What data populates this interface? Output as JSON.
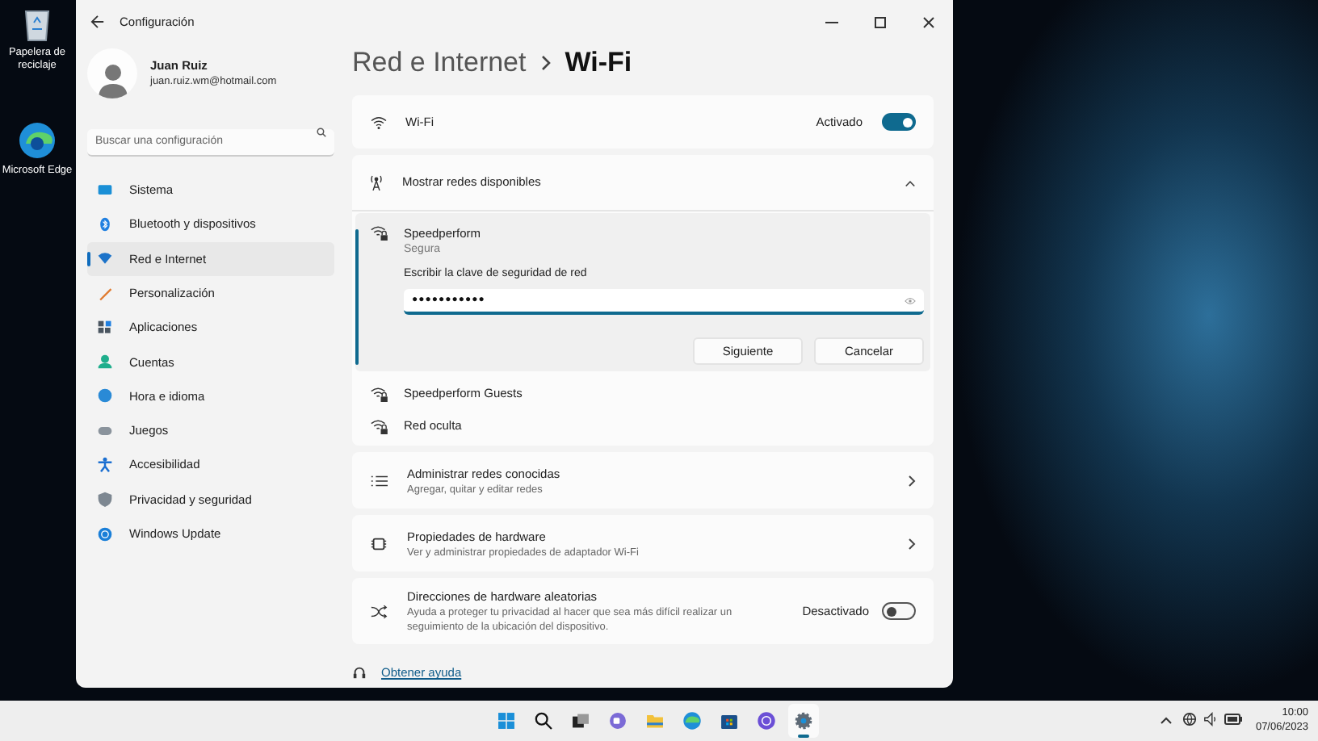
{
  "desktop_icons": [
    {
      "label": "Papelera de reciclaje",
      "kind": "recycle"
    },
    {
      "label": "Microsoft Edge",
      "kind": "edge"
    }
  ],
  "window": {
    "title": "Configuración"
  },
  "user": {
    "name": "Juan Ruiz",
    "email": "juan.ruiz.wm@hotmail.com"
  },
  "search": {
    "placeholder": "Buscar una configuración"
  },
  "sidebar": {
    "items": [
      {
        "label": "Sistema",
        "selected": false,
        "color": "#1a8fd6"
      },
      {
        "label": "Bluetooth y dispositivos",
        "selected": false,
        "color": "#1f7fe0"
      },
      {
        "label": "Red e Internet",
        "selected": true,
        "color": "#1c73c9"
      },
      {
        "label": "Personalización",
        "selected": false,
        "color": "#e07a2f"
      },
      {
        "label": "Aplicaciones",
        "selected": false,
        "color": "#4a5560"
      },
      {
        "label": "Cuentas",
        "selected": false,
        "color": "#1fae8c"
      },
      {
        "label": "Hora e idioma",
        "selected": false,
        "color": "#2a8ad6"
      },
      {
        "label": "Juegos",
        "selected": false,
        "color": "#8a939c"
      },
      {
        "label": "Accesibilidad",
        "selected": false,
        "color": "#1b6fd1"
      },
      {
        "label": "Privacidad y seguridad",
        "selected": false,
        "color": "#7d8791"
      },
      {
        "label": "Windows Update",
        "selected": false,
        "color": "#1a7fd8"
      }
    ]
  },
  "breadcrumb": [
    "Red e Internet",
    "Wi-Fi"
  ],
  "wifi": {
    "label": "Wi-Fi",
    "state": "Activado",
    "on": true
  },
  "networks": {
    "title": "Mostrar redes disponibles",
    "expanded": true,
    "items": [
      {
        "name": "Speedperform",
        "status": "Segura",
        "prompt": "Escribir la clave de seguridad de red",
        "password": "●●●●●●●●●●●",
        "buttons": [
          "Siguiente",
          "Cancelar"
        ],
        "selected": true
      },
      {
        "name": "Speedperform Guests",
        "selected": false
      },
      {
        "name": "Red oculta",
        "selected": false
      }
    ]
  },
  "settings": [
    {
      "kind": "link",
      "title": "Administrar redes conocidas",
      "subtitle": "Agregar, quitar y editar redes"
    },
    {
      "kind": "link",
      "title": "Propiedades de hardware",
      "subtitle": "Ver y administrar propiedades de adaptador Wi-Fi"
    },
    {
      "kind": "toggle",
      "title": "Direcciones de hardware aleatorias",
      "subtitle": "Ayuda a proteger tu privacidad al hacer que sea más difícil realizar un seguimiento de la ubicación del dispositivo.",
      "state": "Desactivado",
      "on": false
    }
  ],
  "help": {
    "label": "Obtener ayuda"
  },
  "taskbar": {
    "apps": [
      {
        "kind": "start",
        "active": false
      },
      {
        "kind": "search",
        "active": false
      },
      {
        "kind": "taskview",
        "active": false
      },
      {
        "kind": "chat",
        "active": false
      },
      {
        "kind": "folder",
        "active": false
      },
      {
        "kind": "edge",
        "active": false
      },
      {
        "kind": "store",
        "active": false
      },
      {
        "kind": "circle",
        "active": false
      },
      {
        "kind": "gear",
        "active": true
      }
    ],
    "time": "10:00",
    "date": "07/06/2023"
  }
}
